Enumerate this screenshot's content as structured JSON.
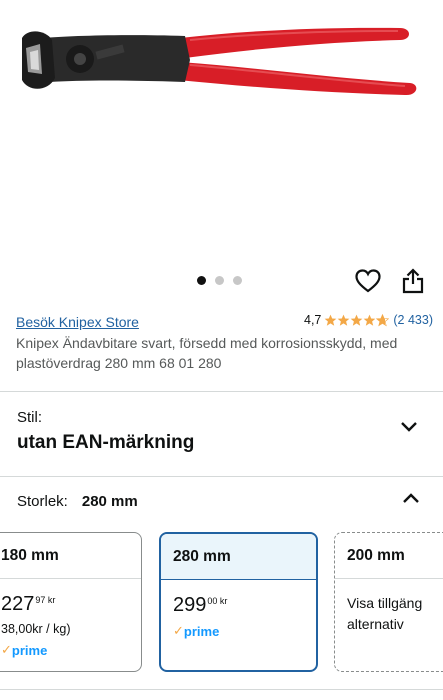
{
  "product": {
    "store_link": "Besök Knipex Store",
    "rating_value": "4,7",
    "rating_stars": 4.7,
    "rating_count": "(2 433)",
    "title": "Knipex Ändavbitare svart, försedd med korrosionsskydd, med plastöverdrag 280 mm 68 01 280",
    "image_count": 3,
    "active_image": 1
  },
  "style_section": {
    "label": "Stil:",
    "value": "utan EAN-märkning"
  },
  "size_section": {
    "label": "Storlek:",
    "value": "280 mm"
  },
  "size_options": [
    {
      "size": "180 mm",
      "price_main": "227",
      "price_frac": "97 kr",
      "unit_price": "38,00kr / kg)",
      "prime": "prime"
    },
    {
      "size": "280 mm",
      "price_main": "299",
      "price_frac": "00 kr",
      "prime": "prime",
      "selected": true
    },
    {
      "size": "200 mm",
      "availability": "Visa tillgäng alternativ"
    }
  ],
  "colors": {
    "link": "#2162a1",
    "star": "#f3a847",
    "handle": "#d81e27",
    "selected_border": "#2162a1",
    "prime_blue": "#1399ff"
  },
  "icons": [
    "heart-icon",
    "share-icon",
    "chevron-down-icon",
    "chevron-up-icon",
    "star-icon"
  ]
}
